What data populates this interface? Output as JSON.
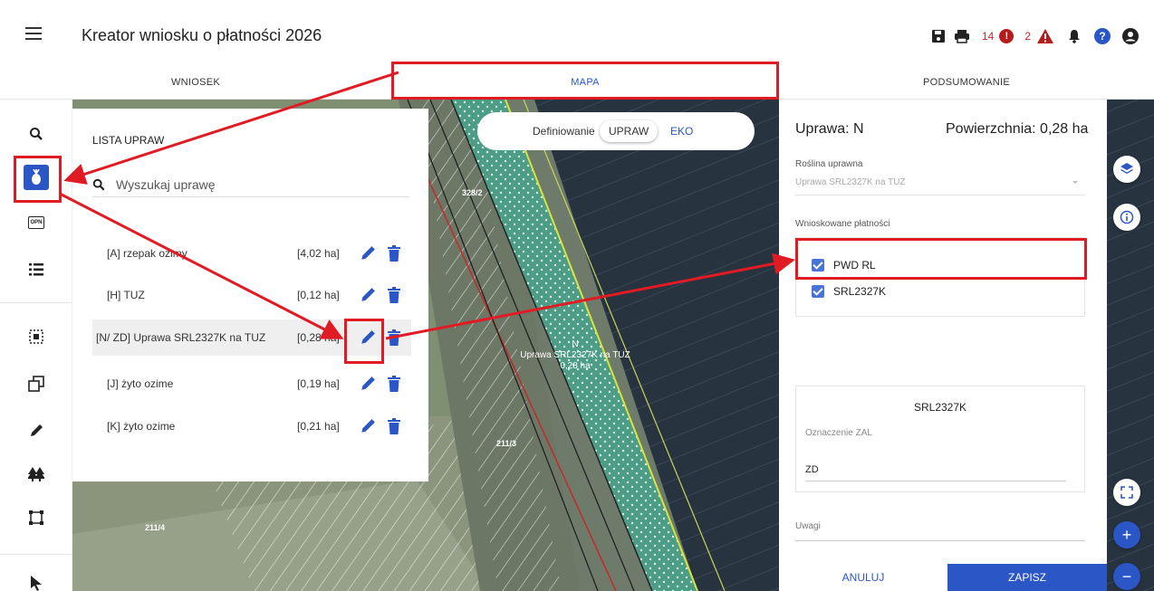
{
  "app": {
    "title": "Kreator wniosku o płatności 2026",
    "error_count": "14",
    "warning_count": "2"
  },
  "tabs": [
    {
      "label": "WNIOSEK"
    },
    {
      "label": "MAPA"
    },
    {
      "label": "PODSUMOWANIE"
    }
  ],
  "toolbar": {
    "icons": [
      "search-icon",
      "crop-icon",
      "opn-icon",
      "list-icon",
      "select-area-icon",
      "copy-icon",
      "edit-icon",
      "trees-icon",
      "polygon-icon",
      "cursor-icon"
    ],
    "opn_label": "OPN"
  },
  "crop_list": {
    "title": "LISTA UPRAW",
    "search_placeholder": "Wyszukaj uprawę",
    "items": [
      {
        "name": "[A] rzepak ozimy",
        "area": "[4,02 ha]"
      },
      {
        "name": "[H] TUZ",
        "area": "[0,12 ha]"
      },
      {
        "name": "[N/ ZD] Uprawa SRL2327K na TUZ",
        "area": "[0,28 ha]"
      },
      {
        "name": "[J] żyto ozime",
        "area": "[0,19 ha]"
      },
      {
        "name": "[K] żyto ozime",
        "area": "[0,21 ha]"
      }
    ]
  },
  "mode_switch": {
    "label": "Definiowanie",
    "option_upraw": "UPRAW",
    "option_eko": "EKO"
  },
  "map": {
    "parcel_labels": [
      "328/2",
      "211/3",
      "211/4"
    ],
    "selected_label_line1": "N",
    "selected_label_line2": "Uprawa SRL2327K na TUZ",
    "selected_label_line3": "0,28 ha"
  },
  "form": {
    "title": "Uprawa: N",
    "area": "Powierzchnia: 0,28 ha",
    "plant_label": "Roślina uprawna",
    "plant_value": "Uprawa SRL2327K na TUZ",
    "payments_label": "Wnioskowane płatności",
    "payments": [
      {
        "label": "PWD RL",
        "checked": true
      },
      {
        "label": "SRL2327K",
        "checked": true
      }
    ],
    "card_title": "SRL2327K",
    "zal_label": "Oznaczenie ZAL",
    "zal_value": "ZD",
    "notes_label": "Uwagi",
    "cancel_label": "ANULUJ",
    "save_label": "ZAPISZ"
  },
  "colors": {
    "accent": "#2b56c5",
    "highlight_red": "#e01b24",
    "error_red": "#b71c1c"
  }
}
